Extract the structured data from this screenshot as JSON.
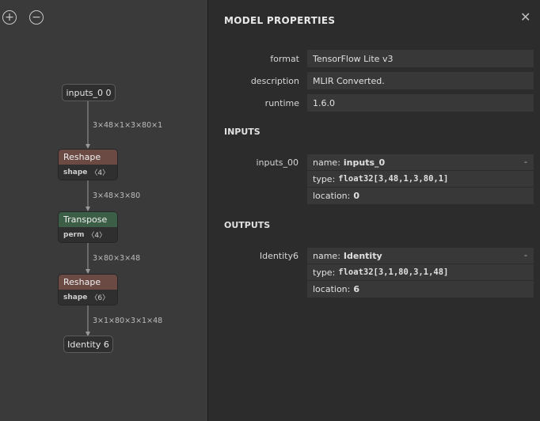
{
  "toolbar": {
    "zoom_in_icon": "zoom-in-icon",
    "zoom_out_icon": "zoom-out-icon"
  },
  "graph": {
    "input_node": "inputs_0 0",
    "edges": [
      "3×48×1×3×80×1",
      "3×48×3×80",
      "3×80×3×48",
      "3×1×80×3×1×48"
    ],
    "nodes": [
      {
        "op": "Reshape",
        "attr_name": "shape",
        "attr_value": "〈4〉"
      },
      {
        "op": "Transpose",
        "attr_name": "perm",
        "attr_value": "〈4〉"
      },
      {
        "op": "Reshape",
        "attr_name": "shape",
        "attr_value": "〈6〉"
      }
    ],
    "output_node": "Identity 6",
    "colors": {
      "reshape": "#6b4a44",
      "transpose": "#3c5e46"
    }
  },
  "sidebar": {
    "title": "MODEL PROPERTIES",
    "close": "✕",
    "properties": [
      {
        "name": "format",
        "value": "TensorFlow Lite v3"
      },
      {
        "name": "description",
        "value": "MLIR Converted."
      },
      {
        "name": "runtime",
        "value": "1.6.0"
      }
    ],
    "inputs_title": "INPUTS",
    "outputs_title": "OUTPUTS",
    "input": {
      "label": "inputs_00",
      "name_key": "name:",
      "name_val": "inputs_0",
      "type_key": "type:",
      "type_val": "float32[3,48,1,3,80,1]",
      "loc_key": "location:",
      "loc_val": "0",
      "expand": "-"
    },
    "output": {
      "label": "Identity6",
      "name_key": "name:",
      "name_val": "Identity",
      "type_key": "type:",
      "type_val": "float32[3,1,80,3,1,48]",
      "loc_key": "location:",
      "loc_val": "6",
      "expand": "-"
    }
  }
}
